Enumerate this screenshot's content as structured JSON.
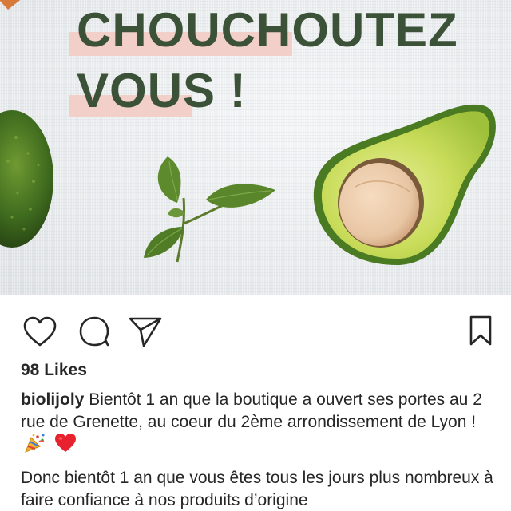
{
  "post": {
    "headline_line1": "CHOUCHOUTEZ",
    "headline_line2": "VOUS !",
    "colors": {
      "headline": "#3c5238",
      "highlight": "#f3cfca",
      "avocado_skin": "#3e6a1e",
      "avocado_flesh": "#c9dc5a",
      "pit": "#e8c6a4"
    }
  },
  "actions": {
    "like_icon": "heart-icon",
    "comment_icon": "comment-icon",
    "share_icon": "paper-plane-icon",
    "save_icon": "bookmark-icon"
  },
  "likes_text": "98 Likes",
  "caption": {
    "username": "biolijoly",
    "text": "Bientôt 1 an que la boutique a ouvert ses portes au 2 rue de Grenette, au coeur du 2ème arrondissement de Lyon !",
    "emojis": [
      "party-popper-icon",
      "red-heart-icon"
    ],
    "text2": "Donc bientôt 1 an que vous êtes tous les jours plus nombreux à faire confiance à nos produits d’origine"
  }
}
